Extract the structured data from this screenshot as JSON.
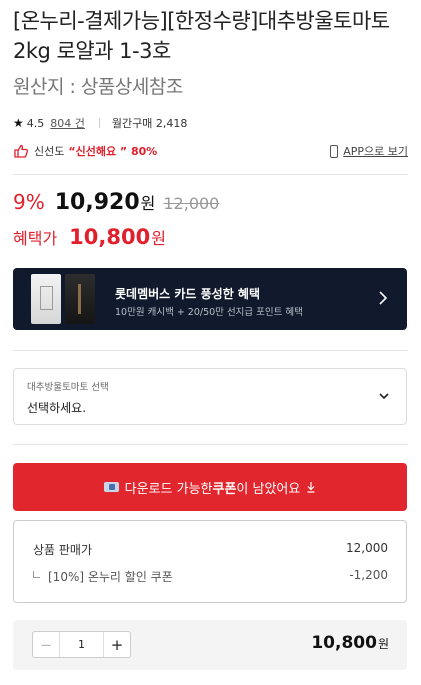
{
  "product": {
    "title": "[온누리-결제가능][한정수량]대추방울토마토 2kg 로얄과 1-3호",
    "origin": "원산지 : 상품상세참조"
  },
  "meta": {
    "rating": "4.5",
    "reviews": "804 건",
    "monthly_sales": "월간구매 2,418"
  },
  "freshness": {
    "label": "신선도",
    "value": "“신선해요 ” 80%",
    "app_view": "APP으로 보기"
  },
  "price": {
    "discount_rate": "9%",
    "sale_price": "10,920",
    "currency": "원",
    "original_price": "12,000",
    "benefit_label": "혜택가",
    "benefit_price": "10,800"
  },
  "banner": {
    "title": "롯데멤버스 카드 풍성한 혜택",
    "subtitle": "10만원 캐시백 + 20/50만 선지급 포인트 혜택"
  },
  "option_select": {
    "label": "대추방울토마토 선택",
    "placeholder": "선택하세요."
  },
  "coupon_button": {
    "text_before": "다운로드 가능한 ",
    "text_bold": "쿠폰",
    "text_after": "이 남았어요"
  },
  "summary": {
    "rows": [
      {
        "label": "상품 판매가",
        "value": "12,000"
      },
      {
        "label": "[10%] 온누리 할인 쿠폰",
        "value": "-1,200"
      }
    ]
  },
  "order": {
    "quantity": "1",
    "total": "10,800",
    "currency": "원"
  },
  "colors": {
    "accent_red": "#e2262d",
    "banner_bg": "#101a2c"
  },
  "icons": {
    "rating": "star-icon",
    "freshness": "thumbs-up-icon",
    "app": "phone-icon",
    "banner_arrow": "chevron-right-icon",
    "select_arrow": "chevron-down-icon",
    "coupon": "ticket-icon",
    "download": "download-arrow-icon"
  }
}
